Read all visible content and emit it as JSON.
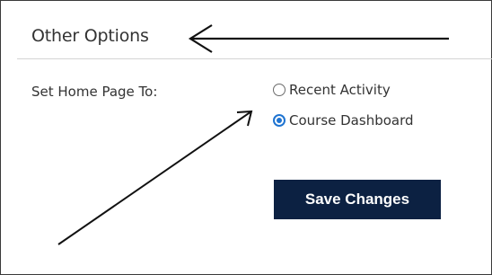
{
  "section": {
    "title": "Other Options"
  },
  "home_page": {
    "label": "Set Home Page To:",
    "options": [
      {
        "label": "Recent Activity",
        "selected": false
      },
      {
        "label": "Course Dashboard",
        "selected": true
      }
    ]
  },
  "actions": {
    "save_label": "Save Changes"
  },
  "colors": {
    "button_bg": "#0c2142",
    "radio_accent": "#1f74d1"
  }
}
